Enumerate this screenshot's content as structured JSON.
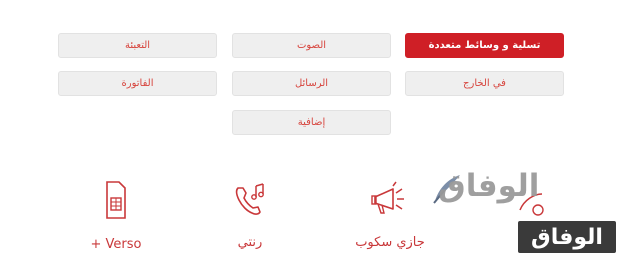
{
  "tabs": {
    "entertainment": "تسلية و وسائط متعددة",
    "voice": "الصوت",
    "recharge": "التعبئة",
    "abroad": "في الخارج",
    "messages": "الرسائل",
    "bill": "الفاتورة",
    "extra": "إضافية"
  },
  "services": {
    "verso": "Verso +",
    "ranati": "رنتي",
    "jazzy": "جازي سكوب"
  },
  "watermark": {
    "top_text": "الوفاق",
    "badge_text": "الوفاق"
  },
  "colors": {
    "accent": "#cf1f26",
    "button_bg": "#efefef",
    "button_text": "#d7443d",
    "watermark_gray": "#9a9a9a",
    "badge_bg": "#3a3a3a"
  },
  "icons": [
    "sim-card-icon",
    "phone-music-icon",
    "megaphone-icon"
  ]
}
